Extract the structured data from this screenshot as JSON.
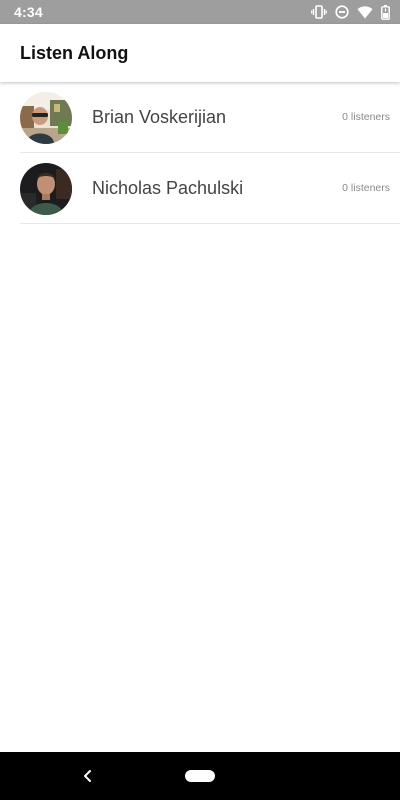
{
  "status_bar": {
    "time": "4:34",
    "icons": [
      "vibrate-icon",
      "do-not-disturb-icon",
      "wifi-icon",
      "battery-icon"
    ]
  },
  "app_bar": {
    "title": "Listen Along"
  },
  "users": [
    {
      "name": "Brian Voskerijian",
      "listeners": "0 listeners",
      "avatar": "avatar-photo"
    },
    {
      "name": "Nicholas Pachulski",
      "listeners": "0 listeners",
      "avatar": "avatar-photo"
    }
  ],
  "navigation": {
    "back": "back-icon",
    "home": "home-pill"
  },
  "colors": {
    "status_bar": "#9e9e9e",
    "nav_bar": "#000000",
    "background": "#ffffff",
    "title_text": "#111111",
    "name_text": "#444444",
    "secondary_text": "#8a8a8a"
  }
}
